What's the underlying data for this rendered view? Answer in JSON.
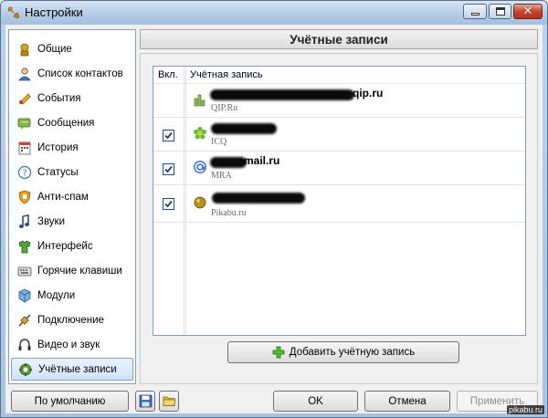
{
  "window": {
    "title": "Настройки"
  },
  "sidebar": {
    "items": [
      {
        "label": "Общие",
        "icon": "general-icon"
      },
      {
        "label": "Список контактов",
        "icon": "contact-list-icon"
      },
      {
        "label": "События",
        "icon": "events-icon"
      },
      {
        "label": "Сообщения",
        "icon": "messages-icon"
      },
      {
        "label": "История",
        "icon": "history-icon"
      },
      {
        "label": "Статусы",
        "icon": "statuses-icon"
      },
      {
        "label": "Анти-спам",
        "icon": "antispam-icon"
      },
      {
        "label": "Звуки",
        "icon": "sounds-icon"
      },
      {
        "label": "Интерфейс",
        "icon": "interface-icon"
      },
      {
        "label": "Горячие клавиши",
        "icon": "hotkeys-icon"
      },
      {
        "label": "Модули",
        "icon": "modules-icon"
      },
      {
        "label": "Подключение",
        "icon": "connection-icon"
      },
      {
        "label": "Видео и звук",
        "icon": "video-audio-icon"
      },
      {
        "label": "Учётные записи",
        "icon": "accounts-icon",
        "selected": true
      }
    ]
  },
  "panel": {
    "title": "Учётные записи",
    "columns": {
      "enabled": "Вкл.",
      "account": "Учётная запись"
    },
    "accounts": [
      {
        "name_visible": "qip.ru",
        "protocol": "QIP.Ru",
        "checked": false,
        "icon": "qip-icon"
      },
      {
        "name_visible": "",
        "protocol": "ICQ",
        "checked": true,
        "icon": "icq-flower-icon"
      },
      {
        "name_visible": "mail.ru",
        "protocol": "MRA",
        "checked": true,
        "icon": "mra-at-icon"
      },
      {
        "name_visible": "",
        "protocol": "Pikabu.ru",
        "checked": true,
        "icon": "pikabu-icon"
      }
    ],
    "add_button": "Добавить учётную запись"
  },
  "footer": {
    "default_button": "По умолчанию",
    "ok_button": "OK",
    "cancel_button": "Отмена",
    "apply_button": "Применить"
  },
  "watermark": "pikabu.ru"
}
